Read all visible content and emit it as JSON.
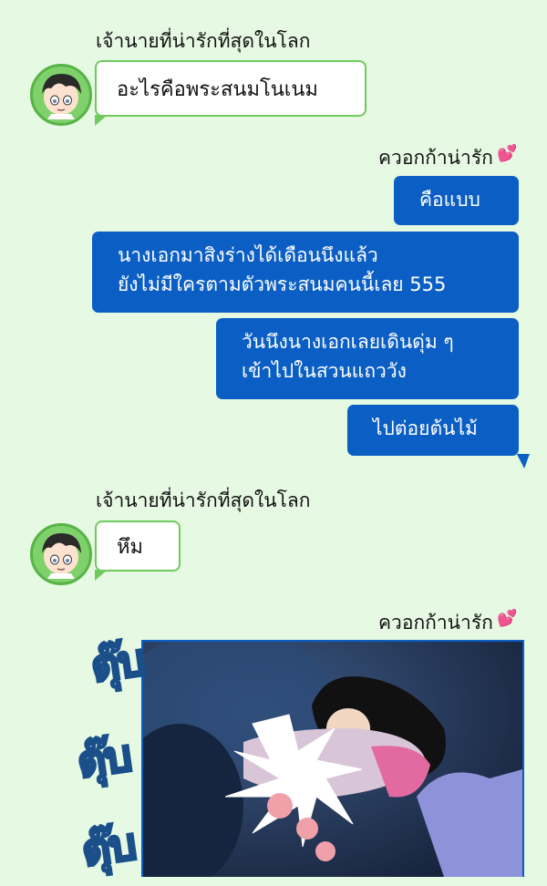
{
  "conversation": {
    "groups": [
      {
        "sender_name": "เจ้านายที่น่ารักที่สุดในโลก",
        "avatar_icon": "boy-avatar-icon",
        "bubble_text": "อะไรคือพระสนมโนเนม"
      },
      {
        "sender_name": "ควอกก้าน่ารัก",
        "heart_icon": "💕",
        "messages": [
          "คือแบบ",
          "นางเอกมาสิงร่างได้เดือนนึงแล้ว",
          "ยังไม่มีใครตามตัวพระสนมคนนี้เลย 555",
          "วันนึงนางเอกเลยเดินดุ่ม ๆ",
          "เข้าไปในสวนแถววัง",
          "ไปต่อยต้นไม้"
        ]
      },
      {
        "sender_name": "เจ้านายที่น่ารักที่สุดในโลก",
        "avatar_icon": "boy-avatar-icon",
        "bubble_text": "หึม"
      },
      {
        "sender_name": "ควอกก้าน่ารัก",
        "heart_icon": "💕",
        "image_sfx": [
          "ตุ๊บ",
          "ตุ๊บ",
          "ตุ๊บ"
        ]
      }
    ]
  },
  "colors": {
    "background": "#e6f9e3",
    "outgoing_bubble": "#0b5fc4",
    "incoming_border": "#6fca5c",
    "avatar_ring": "#57b446"
  }
}
